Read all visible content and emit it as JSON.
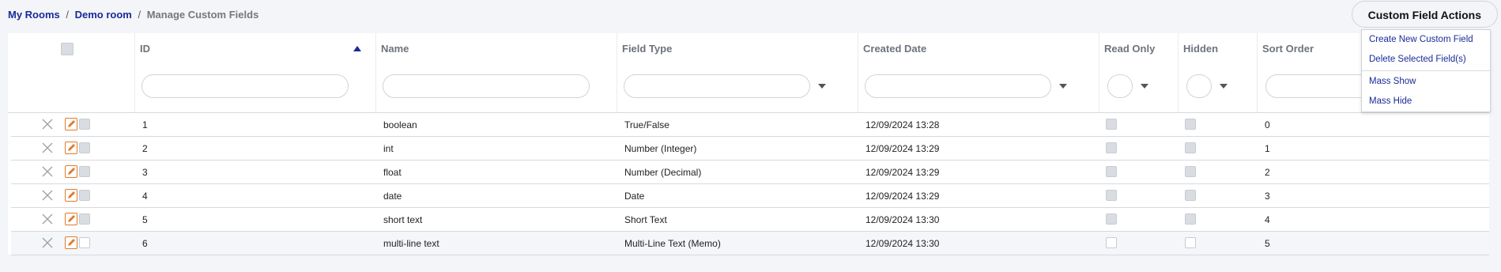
{
  "breadcrumb": {
    "item1": "My Rooms",
    "sep": "/",
    "item2": "Demo room",
    "current": "Manage Custom Fields"
  },
  "actions": {
    "button": "Custom Field Actions",
    "menu": [
      "Create New Custom Field",
      "Delete Selected Field(s)",
      "Mass Show",
      "Mass Hide"
    ]
  },
  "columns": {
    "id": "ID",
    "name": "Name",
    "field_type": "Field Type",
    "created": "Created Date",
    "read_only": "Read Only",
    "hidden": "Hidden",
    "sort_order": "Sort Order"
  },
  "sort": {
    "column": "ID",
    "direction": "ascending"
  },
  "rows": [
    {
      "id": "1",
      "name": "boolean",
      "type": "True/False",
      "created": "12/09/2024 13:28",
      "sort": "0",
      "locked": true
    },
    {
      "id": "2",
      "name": "int",
      "type": "Number (Integer)",
      "created": "12/09/2024 13:29",
      "sort": "1",
      "locked": true
    },
    {
      "id": "3",
      "name": "float",
      "type": "Number (Decimal)",
      "created": "12/09/2024 13:29",
      "sort": "2",
      "locked": true
    },
    {
      "id": "4",
      "name": "date",
      "type": "Date",
      "created": "12/09/2024 13:29",
      "sort": "3",
      "locked": true
    },
    {
      "id": "5",
      "name": "short text",
      "type": "Short Text",
      "created": "12/09/2024 13:30",
      "sort": "4",
      "locked": true
    },
    {
      "id": "6",
      "name": "multi-line text",
      "type": "Multi-Line Text (Memo)",
      "created": "12/09/2024 13:30",
      "sort": "5",
      "locked": false
    }
  ],
  "colors": {
    "link": "#1a2a99",
    "edit_icon": "#e07a2b"
  },
  "icons": {
    "delete": "close-icon",
    "edit": "edit-icon",
    "sort": "sort-asc-icon",
    "filter_dropdown": "chevron-down-icon"
  }
}
